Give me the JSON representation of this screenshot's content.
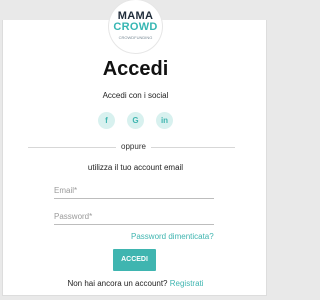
{
  "brand": {
    "name_top": "MAMA",
    "name_bottom": "CROWD",
    "tagline": "CROWDFUNDING"
  },
  "auth": {
    "title": "Accedi",
    "social_label": "Accedi con i social",
    "social_buttons": [
      "f",
      "G",
      "in"
    ],
    "divider_text": "oppure",
    "email_label": "utilizza il tuo account email",
    "email_placeholder": "Email*",
    "password_placeholder": "Password*",
    "forgot_link": "Password dimenticata?",
    "submit_label": "ACCEDI",
    "register_prompt": "Non hai ancora un account?",
    "register_link": "Registrati"
  },
  "colors": {
    "accent": "#3fb5b0",
    "social_bg": "#d8f1ef",
    "page_bg": "#e9e9e9"
  },
  "icons": {
    "facebook": "facebook-icon",
    "google": "google-icon",
    "linkedin": "linkedin-icon"
  }
}
